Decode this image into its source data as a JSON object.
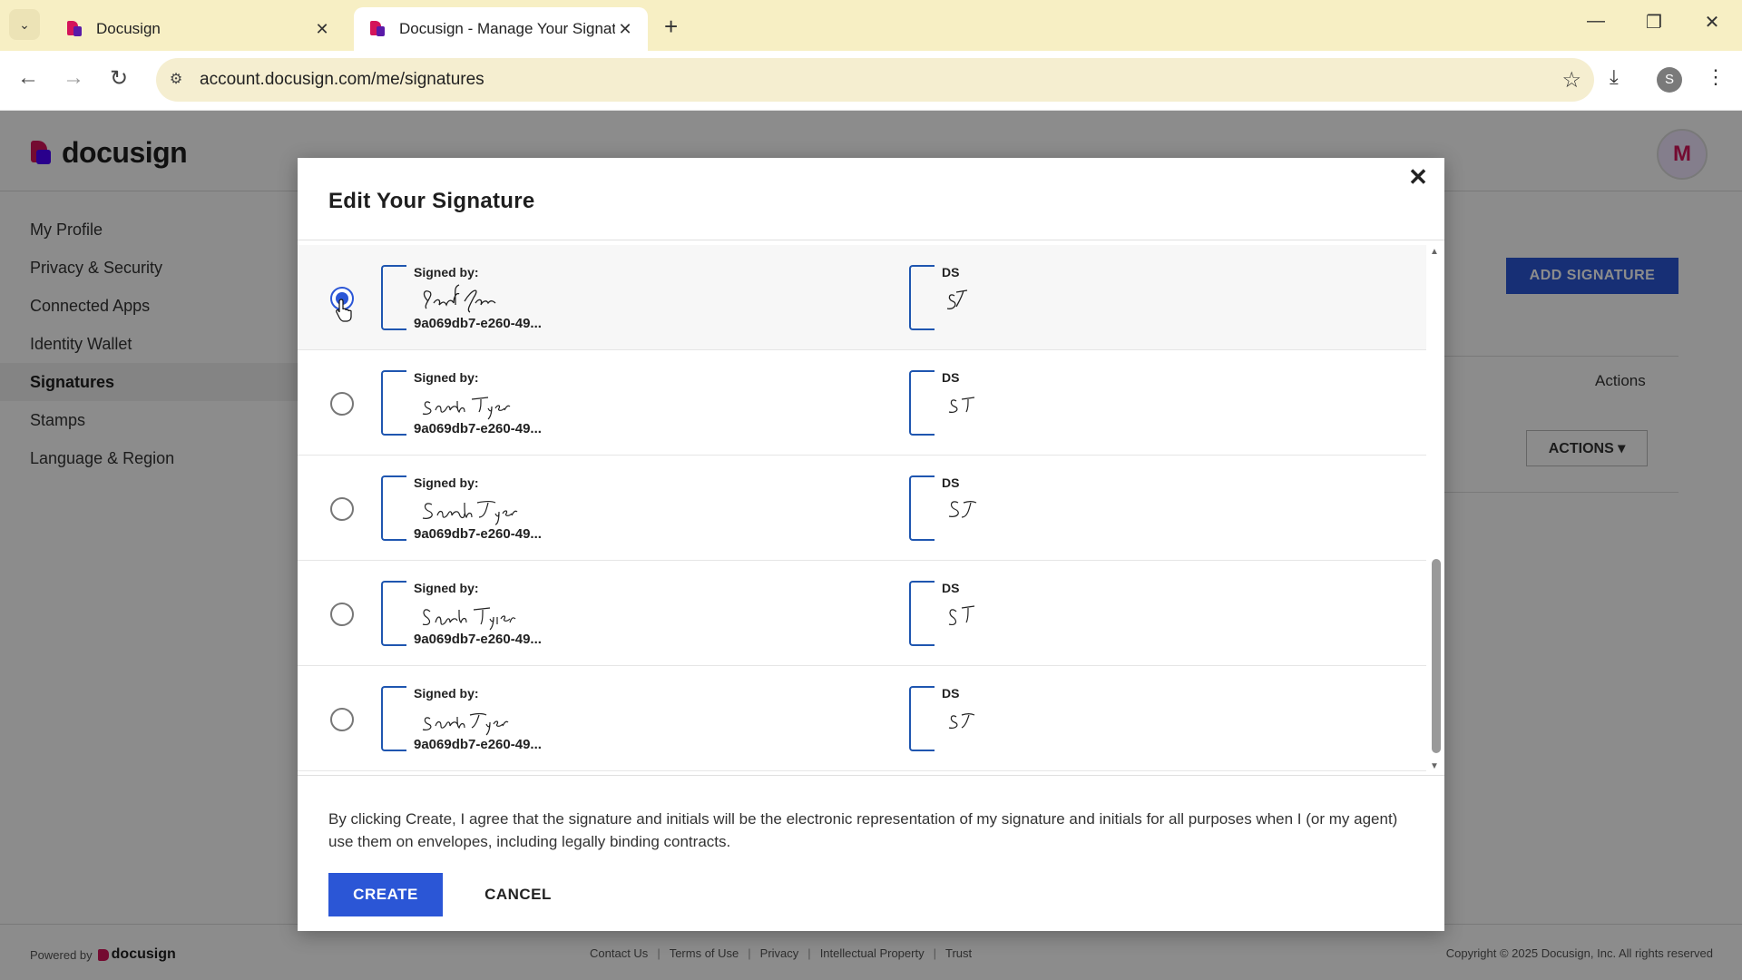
{
  "browser": {
    "tabs": [
      {
        "title": "Docusign",
        "active": false
      },
      {
        "title": "Docusign - Manage Your Signat",
        "active": true
      }
    ],
    "url": "account.docusign.com/me/signatures",
    "profile_initial": "S"
  },
  "app": {
    "logo_text": "docusign",
    "avatar_initial": "M",
    "nav": [
      {
        "label": "My Profile"
      },
      {
        "label": "Privacy & Security"
      },
      {
        "label": "Connected Apps"
      },
      {
        "label": "Identity Wallet"
      },
      {
        "label": "Signatures"
      },
      {
        "label": "Stamps"
      },
      {
        "label": "Language & Region"
      }
    ],
    "active_nav": "Signatures",
    "add_signature_label": "ADD SIGNATURE",
    "actions_column": "Actions",
    "actions_button": "ACTIONS"
  },
  "modal": {
    "title": "Edit Your Signature",
    "signatures": [
      {
        "signed_by": "Signed by:",
        "id": "9a069db7-e260-49...",
        "ds": "DS",
        "selected": true
      },
      {
        "signed_by": "Signed by:",
        "id": "9a069db7-e260-49...",
        "ds": "DS",
        "selected": false
      },
      {
        "signed_by": "Signed by:",
        "id": "9a069db7-e260-49...",
        "ds": "DS",
        "selected": false
      },
      {
        "signed_by": "Signed by:",
        "id": "9a069db7-e260-49...",
        "ds": "DS",
        "selected": false
      },
      {
        "signed_by": "Signed by:",
        "id": "9a069db7-e260-49...",
        "ds": "DS",
        "selected": false
      }
    ],
    "disclaimer": "By clicking Create, I agree that the signature and initials will be the electronic representation of my signature and initials for all purposes when I (or my agent) use them on envelopes, including legally binding contracts.",
    "create_label": "CREATE",
    "cancel_label": "CANCEL"
  },
  "footer": {
    "powered_by": "Powered by",
    "powered_logo": "docusign",
    "links": [
      "Contact Us",
      "Terms of Use",
      "Privacy",
      "Intellectual Property",
      "Trust"
    ],
    "copyright": "Copyright © 2025 Docusign, Inc. All rights reserved"
  },
  "colors": {
    "primary": "#2b56d6",
    "bracket": "#1f56b0",
    "brand_magenta": "#d4145a",
    "brand_purple": "#4c00ff"
  }
}
